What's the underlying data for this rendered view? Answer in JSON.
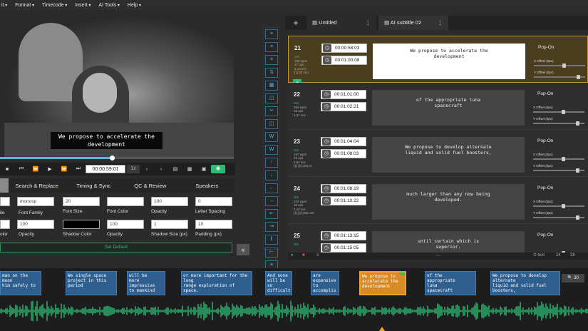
{
  "menubar": {
    "items": [
      "it",
      "Format",
      "Timecode",
      "Insert",
      "AI Tools",
      "Help"
    ]
  },
  "video": {
    "caption_line1": "We propose to accelerate the",
    "caption_line2": "development",
    "progress": 0.48
  },
  "controls": {
    "timecode": "00:00:59:01",
    "speed": "1x"
  },
  "tabs": [
    "Search & Replace",
    "Timing & Sync",
    "QC & Review",
    "Speakers"
  ],
  "style": {
    "font_family_value": "monosp",
    "font_size_value": "20",
    "opacity_value": "100",
    "letter_spacing_value": "0",
    "opacity2_value": "100",
    "shadow_opacity_value": "100",
    "shadow_size_value": "1",
    "padding_value": "10",
    "labels": {
      "ile": "ile",
      "font_family": "Font Family",
      "font_size": "Font Size",
      "font_color": "Font Color",
      "opacity": "Opacity",
      "letter_spacing": "Letter Spacing",
      "olor": "olor",
      "opacity2": "Opacity",
      "shadow_color": "Shadow Color",
      "opacity3": "Opacity",
      "shadow_size": "Shadow Size (px)",
      "padding": "Padding (px)"
    },
    "set_default": "Set Default"
  },
  "subtitle_tabs": [
    {
      "label": "Untitled"
    },
    {
      "label": "AI subtitle 02"
    }
  ],
  "rows": [
    {
      "num": "21",
      "meta1": "SIS",
      "meta2": "156 wpm",
      "meta3": "17 cps",
      "meta4": "2.19 sec",
      "meta5": "[1] [2] (41)",
      "tin": "00:00:58:03",
      "tout": "00:01:00:08",
      "text1": "We propose to accelerate the",
      "text2": "development",
      "popon": "Pop-On",
      "x": "X Offset (0px)",
      "y": "Y Offset (0px)"
    },
    {
      "num": "22",
      "meta1": "SIS",
      "meta2": "392 wpm",
      "meta3": "18 cps",
      "meta4": "1.21 sec",
      "meta5": "",
      "tin": "00:01:01:00",
      "tout": "00:01:02:21",
      "text1": "of the appropriate luna",
      "text2": "spacecraft",
      "popon": "Pop-On",
      "x": "X Offset (0px)",
      "y": "Y Offset (0px)"
    },
    {
      "num": "23",
      "meta1": "SIS",
      "meta2": "167 wpm",
      "meta3": "15 cps",
      "meta4": "2.94 sec",
      "meta5": "[1] [2] (33)=0",
      "tin": "00:01:04:04",
      "tout": "00:01:08:03",
      "text1": "We propose to develop alternate",
      "text2": "liquid and solid fuel boosters,",
      "popon": "Pop-On",
      "x": "X Offset (0px)",
      "y": "Y Offset (0px)"
    },
    {
      "num": "24",
      "meta1": "SIS",
      "meta2": "223 wpm",
      "meta3": "16 cps",
      "meta4": "2.10 sec",
      "meta5": "[1] [2] (30)=40",
      "tin": "00:01:08:19",
      "tout": "00:01:10:22",
      "text1": "much larger than any now being",
      "text2": "developed.",
      "popon": "Pop-On",
      "x": "X Offset (0px)",
      "y": "Y Offset (0px)"
    },
    {
      "num": "25",
      "meta1": "SIS",
      "meta2": "",
      "meta3": "",
      "meta4": "",
      "meta5": "",
      "tin": "00:01:13:15",
      "tout": "00:01:15:05",
      "text1": "until certain which is",
      "text2": "superior.",
      "popon": "Pop-On",
      "x": "",
      "y": ""
    }
  ],
  "footer": {
    "info": "24",
    "count": "38"
  },
  "timeline": {
    "segments": [
      {
        "l1": "man on the moon",
        "l2": "him safely to",
        "l3": "",
        "l4": ""
      },
      {
        "l1": "We single space",
        "l2": "project in this",
        "l3": "period",
        "l4": ""
      },
      {
        "l1": "will be",
        "l2": "more",
        "l3": "impressive",
        "l4": "to mankind"
      },
      {
        "l1": "or more important for the",
        "l2": "long",
        "l3": "range exploration of",
        "l4": "space."
      },
      {
        "l1": "And none",
        "l2": "will be",
        "l3": "so",
        "l4": "difficult"
      },
      {
        "l1": "are",
        "l2": "expensive",
        "l3": "to",
        "l4": "accomplis"
      },
      {
        "l1": "We propose to",
        "l2": "accelerate the",
        "l3": "development",
        "l4": ""
      },
      {
        "l1": "of the",
        "l2": "appropriate",
        "l3": "luna",
        "l4": "spacecraft"
      },
      {
        "l1": "We propose to develop",
        "l2": "alternate",
        "l3": "liquid and solid fuel",
        "l4": "boosters,"
      }
    ],
    "zoom": "30"
  },
  "colors": {
    "accent": "#2dbb74",
    "blue": "#4fb3e8",
    "segment": "#2f5f8f",
    "active": "#d88a25",
    "wave": "#2dbb74"
  }
}
